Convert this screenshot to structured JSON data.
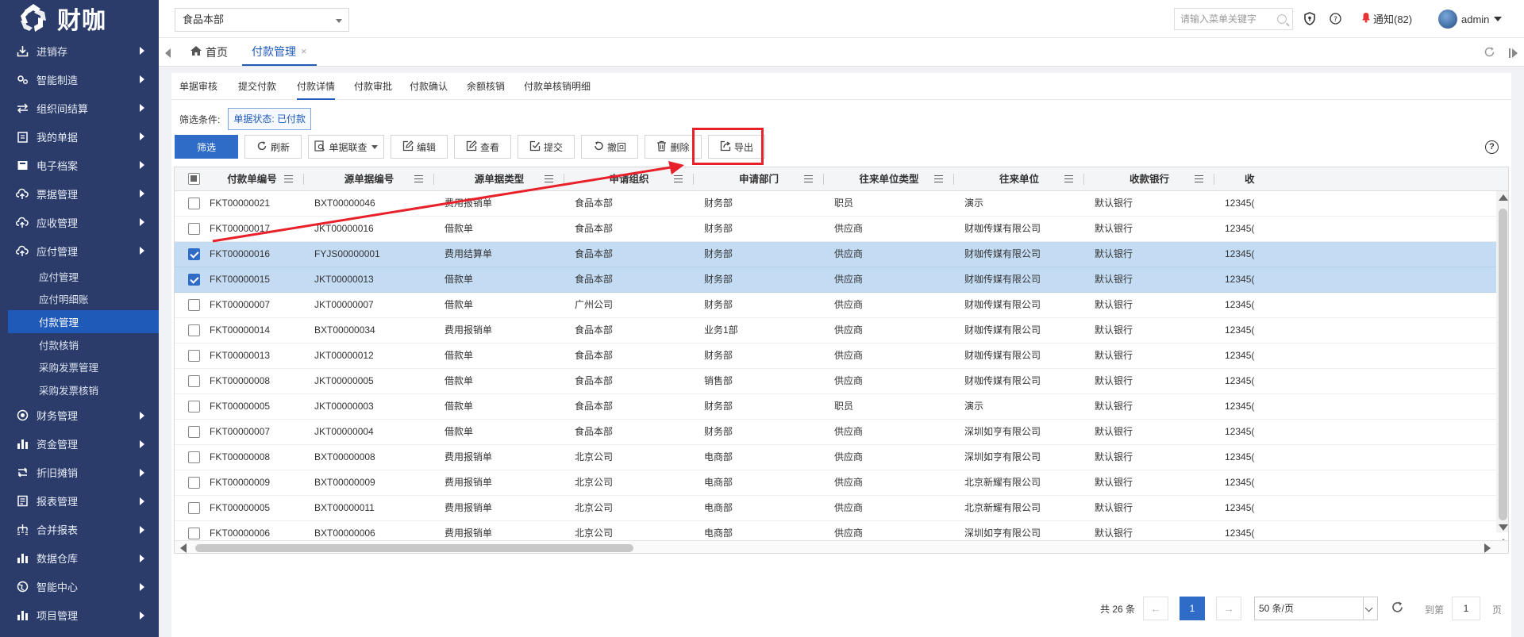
{
  "brand": {
    "logo_text": "财咖"
  },
  "sidebar": {
    "items": [
      {
        "label": "进销存",
        "icon": "download-icon"
      },
      {
        "label": "智能制造",
        "icon": "gears-icon"
      },
      {
        "label": "组织间结算",
        "icon": "exchange-icon"
      },
      {
        "label": "我的单据",
        "icon": "clipboard-icon"
      },
      {
        "label": "电子档案",
        "icon": "archive-icon"
      },
      {
        "label": "票据管理",
        "icon": "cloud-upload-icon"
      },
      {
        "label": "应收管理",
        "icon": "cloud-upload-icon"
      },
      {
        "label": "应付管理",
        "icon": "cloud-upload-icon"
      }
    ],
    "sub_items": [
      {
        "label": "应付管理"
      },
      {
        "label": "应付明细账"
      },
      {
        "label": "付款管理"
      },
      {
        "label": "付款核销"
      },
      {
        "label": "采购发票管理"
      },
      {
        "label": "采购发票核销"
      }
    ],
    "items_after": [
      {
        "label": "财务管理",
        "icon": "target-icon"
      },
      {
        "label": "资金管理",
        "icon": "bar-chart-icon"
      },
      {
        "label": "折旧摊销",
        "icon": "swap-icon"
      },
      {
        "label": "报表管理",
        "icon": "report-icon"
      },
      {
        "label": "合并报表",
        "icon": "sitemap-icon"
      },
      {
        "label": "数据仓库",
        "icon": "bar-chart-icon"
      },
      {
        "label": "智能中心",
        "icon": "globe-icon"
      },
      {
        "label": "项目管理",
        "icon": "bar-chart-icon"
      }
    ]
  },
  "header": {
    "org": "食品本部",
    "search_placeholder": "请输入菜单关键字",
    "notice_label": "通知(82)",
    "user": "admin"
  },
  "tabs": {
    "home": "首页",
    "active": "付款管理"
  },
  "subtabs": [
    "单据审核",
    "提交付款",
    "付款详情",
    "付款审批",
    "付款确认",
    "余额核销",
    "付款单核销明细"
  ],
  "filter": {
    "label": "筛选条件:",
    "tag": "单据状态: 已付款"
  },
  "toolbar": {
    "filter": "筛选",
    "refresh": "刷新",
    "linked": "单据联查",
    "edit": "编辑",
    "view": "查看",
    "submit": "提交",
    "revoke": "撤回",
    "delete": "删除",
    "export": "导出"
  },
  "table": {
    "columns": [
      "付款单编号",
      "源单据编号",
      "源单据类型",
      "申请组织",
      "申请部门",
      "往来单位类型",
      "往来单位",
      "收款银行",
      "收"
    ],
    "rows": [
      {
        "checked": false,
        "cells": [
          "FKT00000021",
          "BXT00000046",
          "费用报销单",
          "食品本部",
          "财务部",
          "职员",
          "演示",
          "默认银行",
          "12345("
        ]
      },
      {
        "checked": false,
        "cells": [
          "FKT00000017",
          "JKT00000016",
          "借款单",
          "食品本部",
          "财务部",
          "供应商",
          "财咖传媒有限公司",
          "默认银行",
          "12345("
        ]
      },
      {
        "checked": true,
        "cells": [
          "FKT00000016",
          "FYJS00000001",
          "费用结算单",
          "食品本部",
          "财务部",
          "供应商",
          "财咖传媒有限公司",
          "默认银行",
          "12345("
        ]
      },
      {
        "checked": true,
        "cells": [
          "FKT00000015",
          "JKT00000013",
          "借款单",
          "食品本部",
          "财务部",
          "供应商",
          "财咖传媒有限公司",
          "默认银行",
          "12345("
        ]
      },
      {
        "checked": false,
        "cells": [
          "FKT00000007",
          "JKT00000007",
          "借款单",
          "广州公司",
          "财务部",
          "供应商",
          "财咖传媒有限公司",
          "默认银行",
          "12345("
        ]
      },
      {
        "checked": false,
        "cells": [
          "FKT00000014",
          "BXT00000034",
          "费用报销单",
          "食品本部",
          "业务1部",
          "供应商",
          "财咖传媒有限公司",
          "默认银行",
          "12345("
        ]
      },
      {
        "checked": false,
        "cells": [
          "FKT00000013",
          "JKT00000012",
          "借款单",
          "食品本部",
          "财务部",
          "供应商",
          "财咖传媒有限公司",
          "默认银行",
          "12345("
        ]
      },
      {
        "checked": false,
        "cells": [
          "FKT00000008",
          "JKT00000005",
          "借款单",
          "食品本部",
          "销售部",
          "供应商",
          "财咖传媒有限公司",
          "默认银行",
          "12345("
        ]
      },
      {
        "checked": false,
        "cells": [
          "FKT00000005",
          "JKT00000003",
          "借款单",
          "食品本部",
          "财务部",
          "职员",
          "演示",
          "默认银行",
          "12345("
        ]
      },
      {
        "checked": false,
        "cells": [
          "FKT00000007",
          "JKT00000004",
          "借款单",
          "食品本部",
          "财务部",
          "供应商",
          "深圳如亨有限公司",
          "默认银行",
          "12345("
        ]
      },
      {
        "checked": false,
        "cells": [
          "FKT00000008",
          "BXT00000008",
          "费用报销单",
          "北京公司",
          "电商部",
          "供应商",
          "深圳如亨有限公司",
          "默认银行",
          "12345("
        ]
      },
      {
        "checked": false,
        "cells": [
          "FKT00000009",
          "BXT00000009",
          "费用报销单",
          "北京公司",
          "电商部",
          "供应商",
          "北京新耀有限公司",
          "默认银行",
          "12345("
        ]
      },
      {
        "checked": false,
        "cells": [
          "FKT00000005",
          "BXT00000011",
          "费用报销单",
          "北京公司",
          "电商部",
          "供应商",
          "北京新耀有限公司",
          "默认银行",
          "12345("
        ]
      },
      {
        "checked": false,
        "cells": [
          "FKT00000006",
          "BXT00000006",
          "费用报销单",
          "北京公司",
          "电商部",
          "供应商",
          "深圳如亨有限公司",
          "默认银行",
          "12345("
        ]
      }
    ]
  },
  "pager": {
    "total": "共 26 条",
    "page": "1",
    "page_size": "50 条/页",
    "goto_label": "到第",
    "goto_value": "1",
    "unit": "页"
  },
  "colors": {
    "sidebar_bg": "#2b3c6b",
    "accent": "#2e6cc8",
    "selected_row": "#c4dcf3",
    "annotation": "#e8202a"
  }
}
